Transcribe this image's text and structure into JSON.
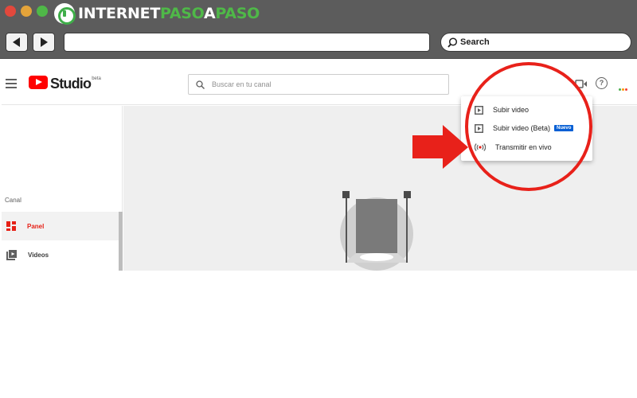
{
  "browser": {
    "brand_part1": "INTERNET",
    "brand_part2": "PASO",
    "brand_part3": "A",
    "brand_part4": "PASO",
    "search_label": "Search",
    "brand_green": "#4fb848"
  },
  "header": {
    "logo_text": "Studio",
    "logo_badge": "beta",
    "search_placeholder": "Buscar en tu canal"
  },
  "sidebar": {
    "section_label": "Canal",
    "items": [
      {
        "label": "Panel",
        "icon": "dashboard-icon",
        "active": true
      },
      {
        "label": "Videos",
        "icon": "videos-icon",
        "active": false
      }
    ]
  },
  "dropdown": {
    "items": [
      {
        "label": "Subir video",
        "icon": "upload-video-icon"
      },
      {
        "label": "Subir video (Beta)",
        "icon": "upload-video-beta-icon",
        "badge": "Nuevo"
      },
      {
        "label": "Transmitir en vivo",
        "icon": "live-stream-icon"
      }
    ]
  },
  "colors": {
    "accent_red": "#e62117",
    "annotation_red": "#e8211a",
    "badge_blue": "#065fd4"
  }
}
